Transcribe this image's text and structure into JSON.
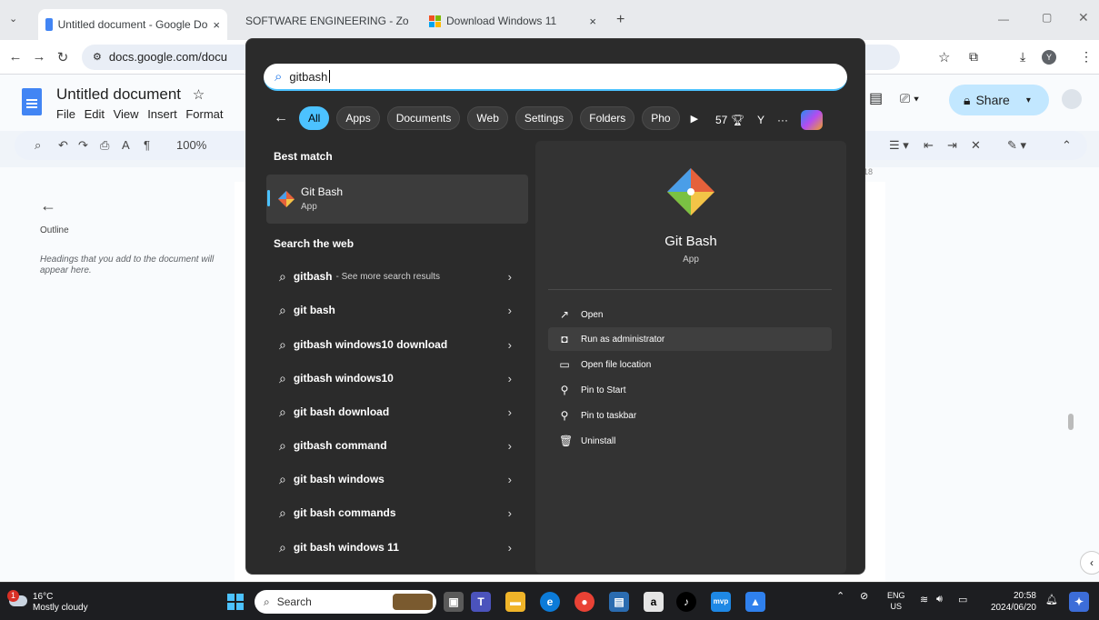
{
  "browser": {
    "tabs": [
      {
        "label": "Untitled document - Google Do",
        "close": "×"
      },
      {
        "label": "SOFTWARE ENGINEERING - Zo",
        "close": "×"
      },
      {
        "label": "Download Windows 11",
        "close": "×"
      }
    ],
    "new_tab": "+",
    "url": "docs.google.com/docu"
  },
  "docs": {
    "title": "Untitled document",
    "menu": [
      "File",
      "Edit",
      "View",
      "Insert",
      "Format"
    ],
    "zoom": "100%",
    "share_label": "Share",
    "ruler_mark": "18",
    "outline": {
      "title": "Outline",
      "hint": "Headings that you add to the document will appear here."
    }
  },
  "search": {
    "query": "gitbash",
    "filters": [
      "All",
      "Apps",
      "Documents",
      "Web",
      "Settings",
      "Folders",
      "Pho"
    ],
    "points": "57",
    "user_initial": "Y",
    "more": "···",
    "best_match_title": "Best match",
    "best_match": {
      "name": "Git Bash",
      "type": "App"
    },
    "web_title": "Search the web",
    "web_results": [
      {
        "text": "gitbash",
        "more": "- See more search results"
      },
      {
        "text": "git bash"
      },
      {
        "text": "gitbash windows10 download"
      },
      {
        "text": "gitbash windows10"
      },
      {
        "text": "git bash download"
      },
      {
        "text": "gitbash command"
      },
      {
        "text": "git bash windows"
      },
      {
        "text": "git bash commands"
      },
      {
        "text": "git bash windows 11"
      }
    ],
    "detail": {
      "name": "Git Bash",
      "type": "App",
      "actions": [
        "Open",
        "Run as administrator",
        "Open file location",
        "Pin to Start",
        "Pin to taskbar",
        "Uninstall"
      ]
    }
  },
  "taskbar": {
    "weather_badge": "1",
    "temp": "16°C",
    "condition": "Mostly cloudy",
    "search_placeholder": "Search",
    "lang_top": "ENG",
    "lang_bottom": "US",
    "time": "20:58",
    "date": "2024/06/20"
  },
  "colors": {
    "accent": "#4cc2ff",
    "panel": "#2b2b2b",
    "share": "#c2e7ff"
  }
}
